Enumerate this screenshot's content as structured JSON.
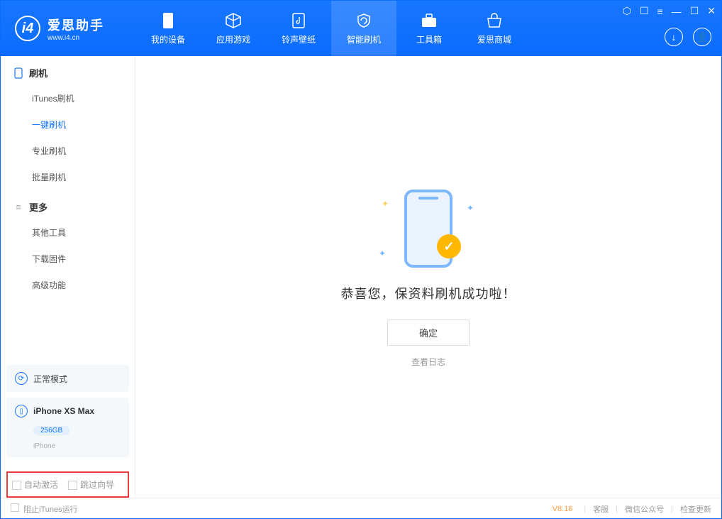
{
  "app": {
    "title": "爱思助手",
    "subtitle": "www.i4.cn"
  },
  "nav": {
    "tabs": [
      {
        "label": "我的设备"
      },
      {
        "label": "应用游戏"
      },
      {
        "label": "铃声壁纸"
      },
      {
        "label": "智能刷机"
      },
      {
        "label": "工具箱"
      },
      {
        "label": "爱思商城"
      }
    ]
  },
  "sidebar": {
    "section1": {
      "title": "刷机",
      "items": [
        "iTunes刷机",
        "一键刷机",
        "专业刷机",
        "批量刷机"
      ],
      "active_index": 1
    },
    "section2": {
      "title": "更多",
      "items": [
        "其他工具",
        "下载固件",
        "高级功能"
      ]
    },
    "mode_label": "正常模式",
    "device": {
      "name": "iPhone XS Max",
      "capacity": "256GB",
      "type": "iPhone"
    },
    "opt1": "自动激活",
    "opt2": "跳过向导"
  },
  "main": {
    "success_text": "恭喜您，保资料刷机成功啦！",
    "ok_button": "确定",
    "log_link": "查看日志"
  },
  "footer": {
    "block_itunes": "阻止iTunes运行",
    "version": "V8.16",
    "links": [
      "客服",
      "微信公众号",
      "检查更新"
    ]
  }
}
